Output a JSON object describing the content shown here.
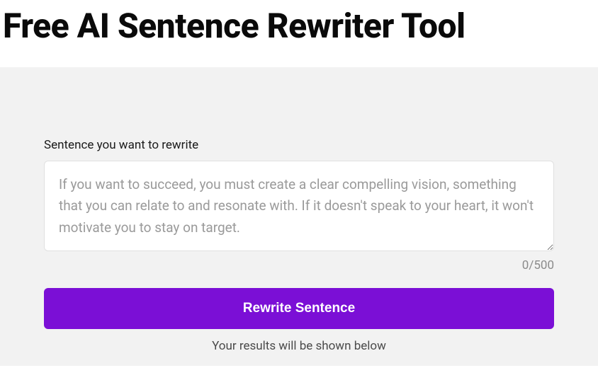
{
  "header": {
    "title": "Free AI Sentence Rewriter Tool"
  },
  "form": {
    "label": "Sentence you want to rewrite",
    "placeholder": "If you want to succeed, you must create a clear compelling vision, something that you can relate to and resonate with. If it doesn't speak to your heart, it won't motivate you to stay on target.",
    "counter": "0/500",
    "button_label": "Rewrite Sentence",
    "results_hint": "Your results will be shown below"
  }
}
